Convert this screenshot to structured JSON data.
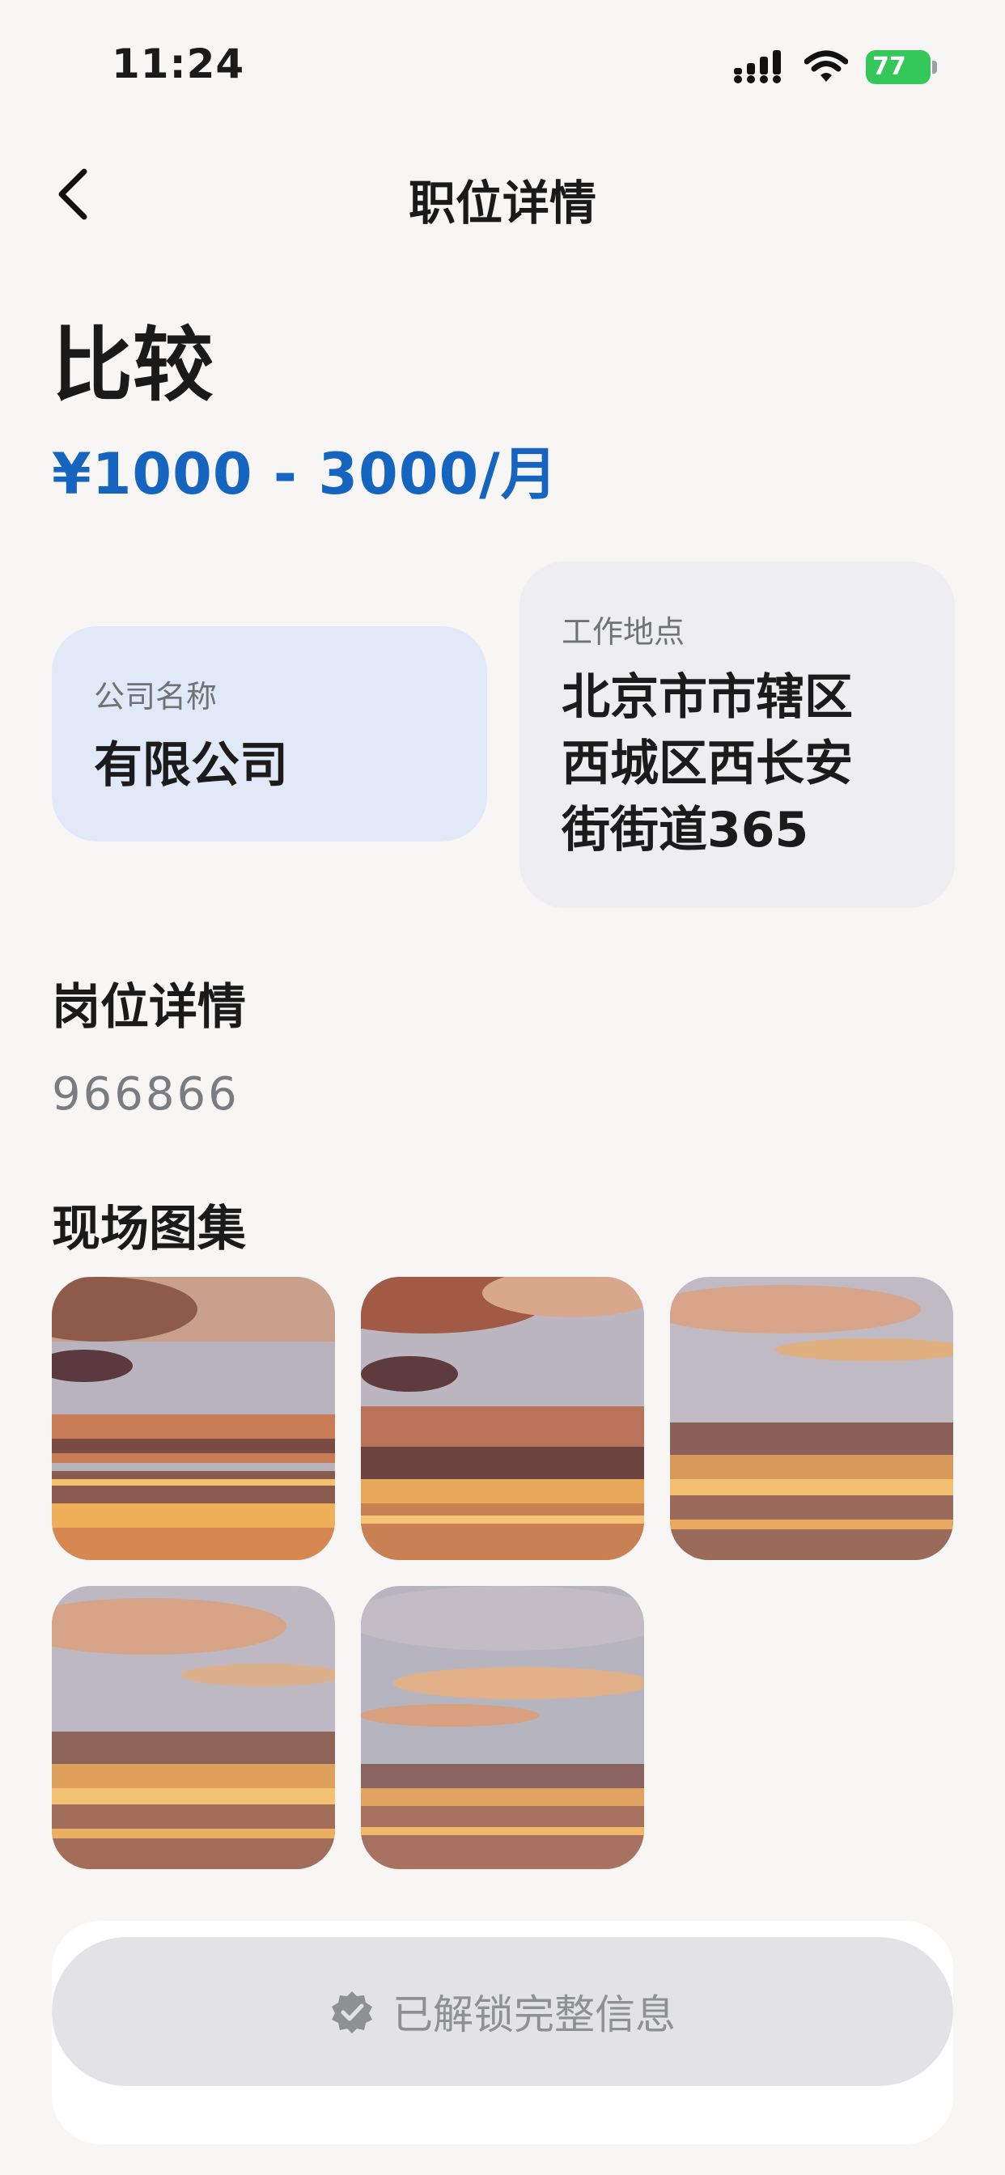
{
  "status_bar": {
    "time": "11:24",
    "battery": "77"
  },
  "nav": {
    "title": "职位详情"
  },
  "job": {
    "title": "比较",
    "salary": "¥1000 - 3000/月"
  },
  "company": {
    "label": "公司名称",
    "value": "有限公司"
  },
  "location": {
    "label": "工作地点",
    "lines": [
      "北京市市辖区",
      "西城区西长安",
      "街街道365"
    ]
  },
  "detail": {
    "heading": "岗位详情",
    "text": "966866"
  },
  "gallery": {
    "heading": "现场图集",
    "photo_count": 5
  },
  "footer": {
    "unlock_label": "已解锁完整信息"
  },
  "colors": {
    "accent": "#1565c0",
    "company_card": "#e1e9f8",
    "location_card": "#eeedef",
    "battery": "#34c759"
  },
  "icons": [
    "chevron-left-icon",
    "signal-icon",
    "wifi-icon",
    "battery-icon",
    "verified-badge-icon"
  ]
}
